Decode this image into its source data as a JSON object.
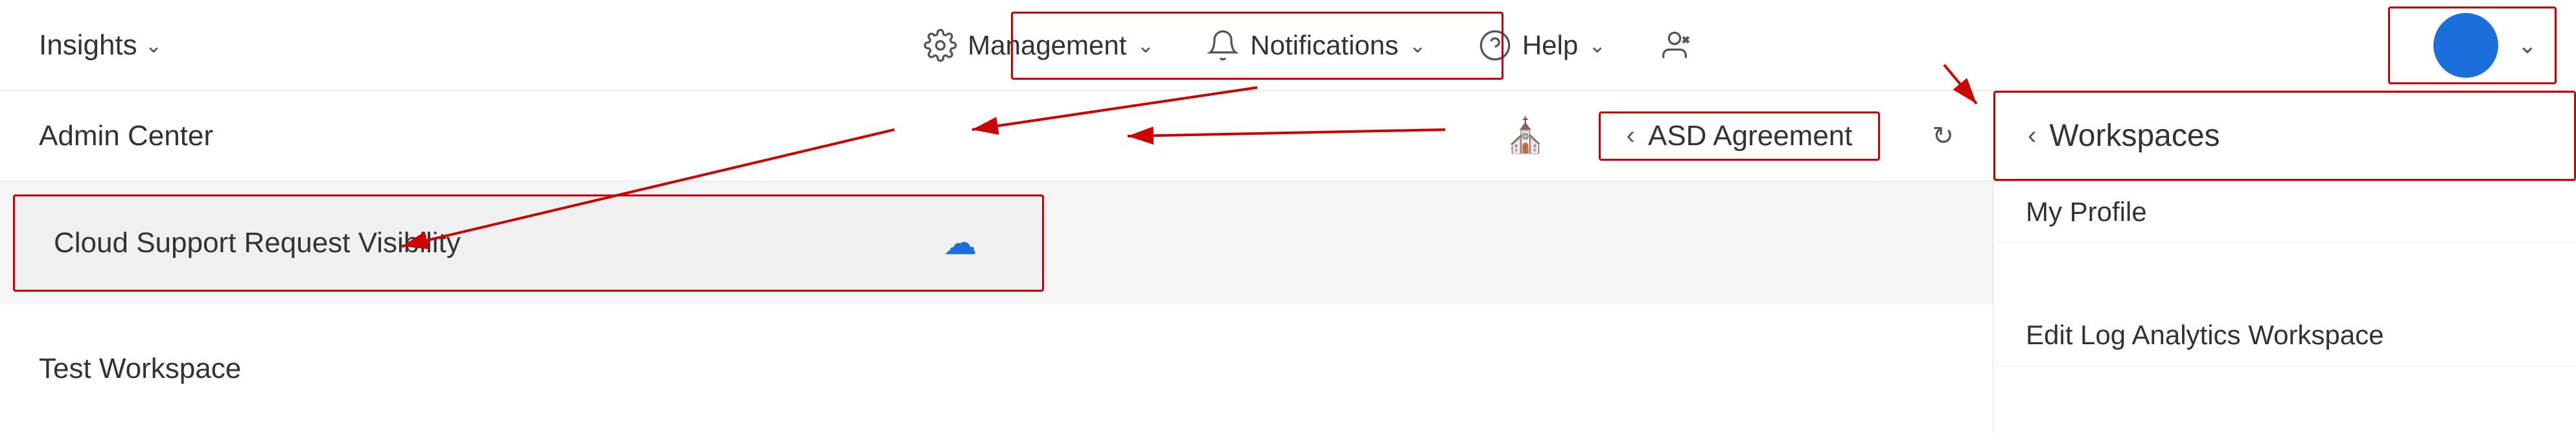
{
  "topNav": {
    "insights_label": "Insights",
    "management_label": "Management",
    "notifications_label": "Notifications",
    "help_label": "Help"
  },
  "secondRow": {
    "admin_center_label": "Admin Center",
    "asd_agreement_label": "ASD Agreement",
    "workspaces_label": "Workspaces"
  },
  "thirdRow": {
    "cloud_support_label": "Cloud Support Request Visibility",
    "my_profile_label": "My Profile"
  },
  "fourthRow": {
    "test_workspace_label": "Test Workspace",
    "edit_log_label": "Edit Log Analytics Workspace"
  }
}
